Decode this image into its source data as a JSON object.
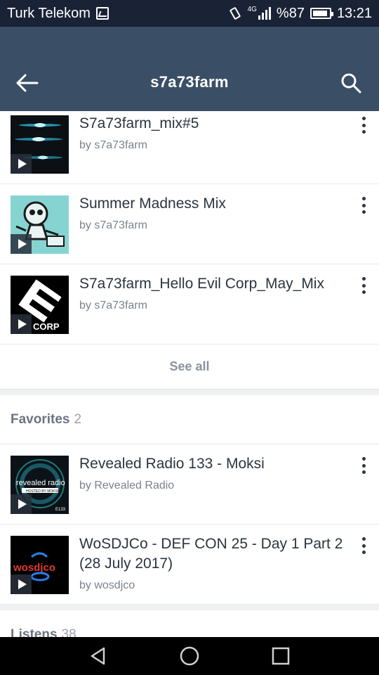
{
  "status": {
    "carrier": "Turk Telekom",
    "network": "4G",
    "battery": "%87",
    "time": "13:21"
  },
  "appbar": {
    "title": "s7a73farm"
  },
  "tracks": [
    {
      "title": "S7a73farm_mix#5",
      "by": "by s7a73farm"
    },
    {
      "title": "Summer Madness Mix",
      "by": "by s7a73farm"
    },
    {
      "title": "S7a73farm_Hello Evil Corp_May_Mix",
      "by": "by s7a73farm",
      "thumb_text": "CORP"
    }
  ],
  "see_all": "See all",
  "favorites": {
    "label": "Favorites",
    "count": "2",
    "items": [
      {
        "title": "Revealed Radio 133 - Moksi",
        "by": "by Revealed Radio",
        "thumb_text": "revealed radio",
        "thumb_sub": "HOSTED BY MOKSI",
        "thumb_num": "E133"
      },
      {
        "title": "WoSDJCo - DEF CON 25 - Day 1 Part 2 (28 July 2017)",
        "by": "by wosdjco",
        "thumb_text": "wosdjco"
      }
    ]
  },
  "listens": {
    "label": "Listens",
    "count": "38"
  },
  "colors": {
    "statusbar": "#1a2236",
    "appbar": "#3a4f66",
    "text": "#2c3440",
    "subtext": "#7a828c"
  }
}
